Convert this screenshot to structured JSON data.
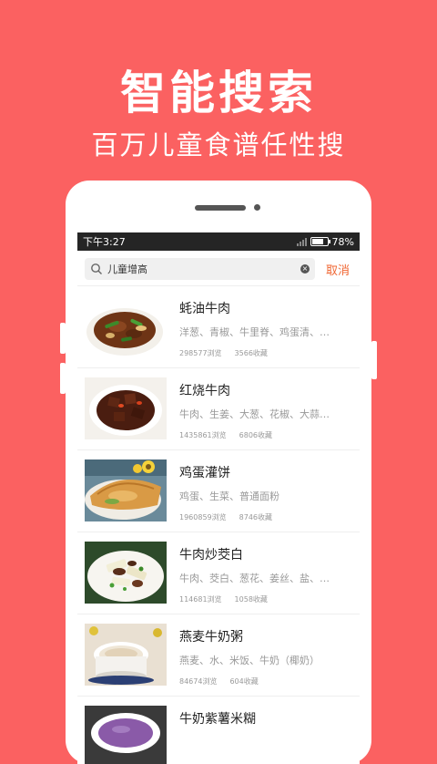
{
  "hero": {
    "title": "智能搜索",
    "subtitle": "百万儿童食谱任性搜"
  },
  "statusbar": {
    "time": "下午3:27",
    "battery": "78%"
  },
  "search": {
    "query": "儿童增高",
    "cancel_label": "取消"
  },
  "recipes": [
    {
      "title": "蚝油牛肉",
      "ingredients": "洋葱、青椒、牛里脊、鸡蛋清、…",
      "views": "298577浏览",
      "favorites": "3566收藏"
    },
    {
      "title": "红烧牛肉",
      "ingredients": "牛肉、生姜、大葱、花椒、大蒜…",
      "views": "1435861浏览",
      "favorites": "6806收藏"
    },
    {
      "title": "鸡蛋灌饼",
      "ingredients": "鸡蛋、生菜、普通面粉",
      "views": "1960859浏览",
      "favorites": "8746收藏"
    },
    {
      "title": "牛肉炒茭白",
      "ingredients": "牛肉、茭白、葱花、姜丝、盐、…",
      "views": "114681浏览",
      "favorites": "1058收藏"
    },
    {
      "title": "燕麦牛奶粥",
      "ingredients": "燕麦、水、米饭、牛奶（椰奶）",
      "views": "84674浏览",
      "favorites": "604收藏"
    },
    {
      "title": "牛奶紫薯米糊",
      "ingredients": "",
      "views": "",
      "favorites": ""
    }
  ],
  "colors": {
    "background": "#fb6161",
    "accent": "#f06632",
    "statusbar": "#252525"
  }
}
